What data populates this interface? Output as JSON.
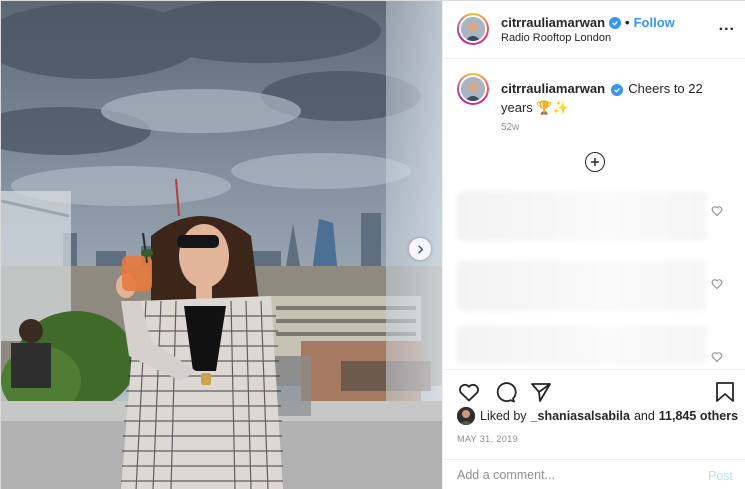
{
  "post": {
    "username": "citrrauliamarwan",
    "follow_label": "Follow",
    "separator": "•",
    "location": "Radio Rooftop London",
    "more_label": "...",
    "caption": {
      "username": "citrrauliamarwan",
      "text": "Cheers to 22 years 🏆✨",
      "time_ago": "52w"
    },
    "likes": {
      "prefix": "Liked by",
      "first_user": "_shaniasalsabila",
      "joiner": "and",
      "others": "11,845 others"
    },
    "date": "MAY 31, 2019"
  },
  "comment_box": {
    "placeholder": "Add a comment...",
    "post_label": "Post"
  },
  "colors": {
    "accent": "#3897f0",
    "post_disabled": "#b2dffc",
    "muted": "#8e8e8e"
  },
  "icons": {
    "like": "heart-icon",
    "comment": "speech-bubble-icon",
    "share": "paper-plane-icon",
    "save": "bookmark-icon",
    "load_more": "plus-circle-icon",
    "next": "chevron-right-icon",
    "verified": "verified-badge-icon"
  }
}
